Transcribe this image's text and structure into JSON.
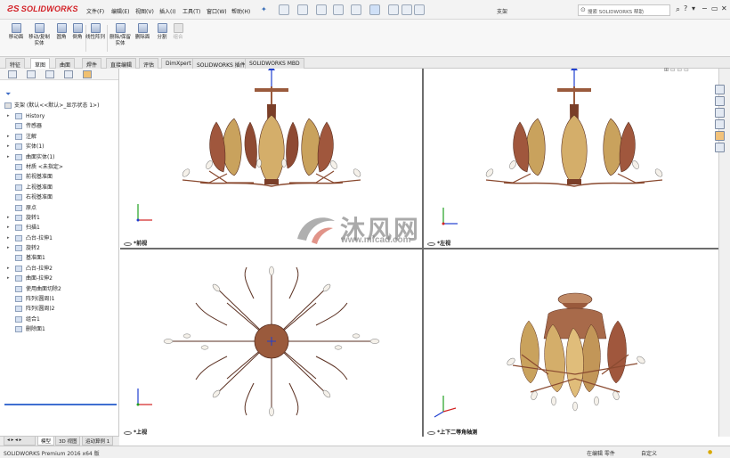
{
  "app": {
    "brand": "SOLIDWORKS",
    "document_title": "支架",
    "menus": [
      "文件(F)",
      "编辑(E)",
      "视图(V)",
      "插入(I)",
      "工具(T)",
      "窗口(W)",
      "帮助(H)"
    ],
    "search_placeholder": "搜索 SOLIDWORKS 帮助"
  },
  "ribbon": {
    "buttons": [
      {
        "label": "移动面",
        "enabled": true
      },
      {
        "label": "移动/复制实体",
        "enabled": true
      },
      {
        "label": "圆角",
        "enabled": true
      },
      {
        "label": "倒角",
        "enabled": true
      },
      {
        "label": "线性阵列",
        "enabled": true
      },
      {
        "label": "删除/保留实体",
        "enabled": true
      },
      {
        "label": "删除面",
        "enabled": true
      },
      {
        "label": "分割",
        "enabled": true
      },
      {
        "label": "组合",
        "enabled": false
      }
    ]
  },
  "tabs": [
    "特征",
    "草图",
    "曲面",
    "焊件",
    "直接编辑",
    "评估",
    "DimXpert",
    "SOLIDWORKS 插件",
    "SOLIDWORKS MBD"
  ],
  "active_tab": "草图",
  "feature_tree": {
    "root": "支架 (默认<<默认>_显示状态 1>)",
    "items": [
      {
        "label": "History",
        "expandable": true
      },
      {
        "label": "传感器",
        "expandable": false
      },
      {
        "label": "注解",
        "expandable": true
      },
      {
        "label": "实体(1)",
        "expandable": true
      },
      {
        "label": "曲面实体(1)",
        "expandable": true
      },
      {
        "label": "材质 <未指定>",
        "expandable": false
      },
      {
        "label": "前视基准面",
        "expandable": false
      },
      {
        "label": "上视基准面",
        "expandable": false
      },
      {
        "label": "右视基准面",
        "expandable": false
      },
      {
        "label": "原点",
        "expandable": false
      },
      {
        "label": "旋转1",
        "expandable": true
      },
      {
        "label": "扫描1",
        "expandable": true
      },
      {
        "label": "凸台-拉伸1",
        "expandable": true
      },
      {
        "label": "旋转2",
        "expandable": true
      },
      {
        "label": "基准面1",
        "expandable": false
      },
      {
        "label": "凸台-拉伸2",
        "expandable": true
      },
      {
        "label": "曲面-拉伸2",
        "expandable": true
      },
      {
        "label": "使用曲面切除2",
        "expandable": false
      },
      {
        "label": "阵列(圆周)1",
        "expandable": false
      },
      {
        "label": "阵列(圆周)2",
        "expandable": false
      },
      {
        "label": "组合1",
        "expandable": false
      },
      {
        "label": "删除面1",
        "expandable": false
      }
    ]
  },
  "bottom_tabs": [
    "模型",
    "3D 视图",
    "运动算例 1"
  ],
  "viewports": {
    "front": "*前视",
    "left": "*左视",
    "top": "*上视",
    "iso": "*上下二等角轴测"
  },
  "watermark": {
    "name": "沐风网",
    "url": "www.mfcad.com"
  },
  "status": {
    "product": "SOLIDWORKS Premium 2016 x64 版",
    "mode": "在编辑 零件",
    "units": "自定义"
  },
  "colors": {
    "brand_red": "#d32026",
    "copper": "#9a5a3c",
    "petal_gold": "#c9a25d",
    "triad_x": "#d22020",
    "triad_y": "#20a020",
    "triad_z": "#2040d0"
  }
}
